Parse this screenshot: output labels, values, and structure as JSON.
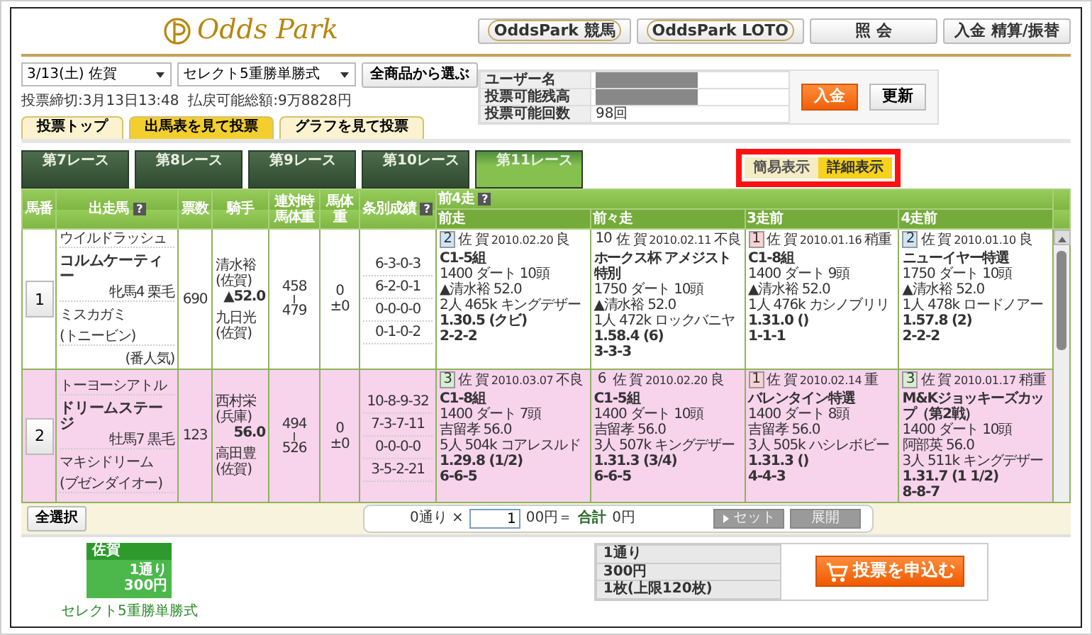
{
  "logo": {
    "text": "Odds Park"
  },
  "top_nav": [
    {
      "label": "OddsPark 競馬",
      "kind": "brand"
    },
    {
      "label": "OddsPark LOTO",
      "kind": "brand"
    },
    {
      "label": "照 会",
      "kind": "plain"
    },
    {
      "label": "入金 精算/振替",
      "kind": "plain"
    }
  ],
  "filters": {
    "venue": "3/13(土) 佐賀",
    "bet_type": "セレクト5重勝単勝式",
    "choose_button": "全商品から選ぶ"
  },
  "deadline_info": "投票締切:3月13日13:48  払戻可能総額:9万8828円",
  "account": {
    "rows": [
      {
        "label": "ユーザー名",
        "masked": true
      },
      {
        "label": "投票可能残高",
        "masked": true
      },
      {
        "label": "投票可能回数",
        "masked": false,
        "value": "98回"
      }
    ],
    "buttons": [
      {
        "label": "入金",
        "kind": "primary"
      },
      {
        "label": "更新",
        "kind": "plain"
      }
    ]
  },
  "view_tabs": [
    {
      "label": "投票トップ",
      "selected": false
    },
    {
      "label": "出馬表を見て投票",
      "selected": true
    },
    {
      "label": "グラフを見て投票",
      "selected": false
    }
  ],
  "race_tabs": [
    {
      "label": "第7レース",
      "selected": false
    },
    {
      "label": "第8レース",
      "selected": false
    },
    {
      "label": "第9レース",
      "selected": false
    },
    {
      "label": "第10レース",
      "selected": false
    },
    {
      "label": "第11レース",
      "selected": true
    }
  ],
  "display_toggle": [
    {
      "label": "簡易表示",
      "selected": false
    },
    {
      "label": "詳細表示",
      "selected": true
    }
  ],
  "table": {
    "columns": [
      {
        "label": "馬番"
      },
      {
        "label": "出走馬",
        "help": "?"
      },
      {
        "label": "票数"
      },
      {
        "label": "騎手"
      },
      {
        "label": "連対時馬体重"
      },
      {
        "label": "馬体重"
      },
      {
        "label": "条別成績",
        "help": "?"
      }
    ],
    "past_runs": {
      "label": "前4走",
      "help": "?",
      "columns": [
        "前走",
        "前々走",
        "3走前",
        "4走前"
      ]
    },
    "rows": [
      {
        "number": "1",
        "sire": "ウイルドラッシュ",
        "name": "コルムケーティー",
        "sex_coat": "牝馬4 栗毛",
        "dam": "ミスカガミ",
        "dam_sire": "(トニービン)",
        "popularity": "(番人気)",
        "votes": "690",
        "jockey": {
          "name": "清水裕",
          "affiliation": "(佐賀)",
          "weight": "▲52.0"
        },
        "trainer": {
          "name": "九日光",
          "affiliation": "(佐賀)"
        },
        "weight_range": [
          "458",
          "479"
        ],
        "body_weight": [
          "0",
          "±0"
        ],
        "records": [
          "6-3-0-3",
          "6-2-0-1",
          "0-0-0-0",
          "0-1-0-2"
        ],
        "runs": [
          {
            "finish": "2",
            "color": "#cde6f7",
            "venue": "佐 賀",
            "date": "2010.02.20",
            "going": "良",
            "race": "C1-5組",
            "course": "1400 ダート 10頭",
            "rider": "▲清水裕 52.0",
            "result": "2人 465k キングデザー",
            "time": "1.30.5 (クビ)",
            "passing": "2-2-2"
          },
          {
            "finish": "10",
            "venue": "佐 賀",
            "date": "2010.02.11",
            "going": "不良",
            "race": "ホークス杯 アメジスト特別",
            "course": "1750 ダート 10頭",
            "rider": "▲清水裕 52.0",
            "result": "1人 472k ロックバニヤ",
            "time": "1.58.4 (6)",
            "passing": "3-3-3"
          },
          {
            "finish": "1",
            "color": "#f8d2d2",
            "venue": "佐 賀",
            "date": "2010.01.16",
            "going": "稍重",
            "race": "C1-8組",
            "course": "1400 ダート 9頭",
            "rider": "▲清水裕 52.0",
            "result": "1人 476k カシノブリリ",
            "time": "1.31.0 ()",
            "passing": "1-1-1"
          },
          {
            "finish": "2",
            "color": "#cde6f7",
            "venue": "佐 賀",
            "date": "2010.01.10",
            "going": "良",
            "race": "ニューイヤー特選",
            "course": "1750 ダート 10頭",
            "rider": "▲清水裕 52.0",
            "result": "1人 478k ロードノアー",
            "time": "1.57.8 (2)",
            "passing": "2-2-2"
          }
        ]
      },
      {
        "number": "2",
        "sire": "トーヨーシアトル",
        "name": "ドリームステージ",
        "sex_coat": "牡馬7 黒毛",
        "dam": "マキシドリーム",
        "dam_sire": "(ブゼンダイオー)",
        "votes": "123",
        "jockey": {
          "name": "西村栄",
          "affiliation": "(兵庫)",
          "weight": "56.0"
        },
        "trainer": {
          "name": "高田豊",
          "affiliation": "(佐賀)"
        },
        "weight_range": [
          "494",
          "526"
        ],
        "body_weight": [
          "0",
          "±0"
        ],
        "records": [
          "10-8-9-32",
          "7-3-7-11",
          "0-0-0-0",
          "3-5-2-21"
        ],
        "runs": [
          {
            "finish": "3",
            "color": "#d5efd0",
            "venue": "佐 賀",
            "date": "2010.03.07",
            "going": "不良",
            "race": "C1-8組",
            "course": "1400 ダート 7頭",
            "rider": "吉留孝 56.0",
            "result": "5人 504k コアレスルド",
            "time": "1.29.8 (1/2)",
            "passing": "6-6-5"
          },
          {
            "finish": "6",
            "venue": "佐 賀",
            "date": "2010.02.20",
            "going": "良",
            "race": "C1-5組",
            "course": "1400 ダート 10頭",
            "rider": "吉留孝 56.0",
            "result": "3人 507k キングデザー",
            "time": "1.31.3 (3/4)",
            "passing": "6-6-5"
          },
          {
            "finish": "1",
            "color": "#f8d2d2",
            "venue": "佐 賀",
            "date": "2010.02.14",
            "going": "重",
            "race": "バレンタイン特選",
            "course": "1400 ダート 8頭",
            "rider": "吉留孝 56.0",
            "result": "3人 505k ハシレボビー",
            "time": "1.31.3 ()",
            "passing": "4-4-3"
          },
          {
            "finish": "3",
            "color": "#d5efd0",
            "venue": "佐 賀",
            "date": "2010.01.17",
            "going": "稍重",
            "race": "M&Kジョッキーズカップ（第2戦）",
            "course": "1400 ダート 10頭",
            "rider": "阿部英 56.0",
            "result": "3人 511k キングデザー",
            "time": "1.31.7 (1 1/2)",
            "passing": "8-8-7"
          }
        ]
      }
    ]
  },
  "footer": {
    "select_all": "全選択",
    "combos": "0通り ×",
    "unit_input": "1",
    "unit_suffix": "00円＝",
    "total_label": "合計",
    "total_value": "0円",
    "buttons": [
      {
        "label": "セット",
        "disabled": true,
        "icon": true
      },
      {
        "label": "展開",
        "disabled": true,
        "icon": false
      }
    ]
  },
  "bet_slip": {
    "venue": "佐賀",
    "combos": "1通り",
    "amount": "300円",
    "caption": "セレクト5重勝単勝式"
  },
  "summary": [
    "1通り",
    "300円",
    "1枚(上限120枚)"
  ],
  "submit": "投票を申込む"
}
